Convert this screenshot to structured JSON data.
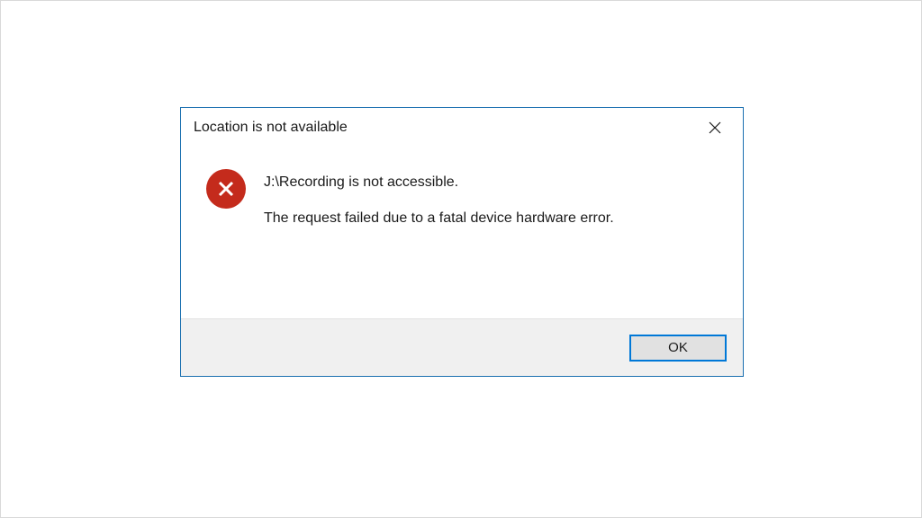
{
  "dialog": {
    "title": "Location is not available",
    "message_primary": "J:\\Recording is not accessible.",
    "message_secondary": "The request failed due to a fatal device hardware error.",
    "ok_label": "OK"
  },
  "colors": {
    "accent": "#0078d7",
    "error": "#c42b1c",
    "border": "#1a6fb0"
  }
}
